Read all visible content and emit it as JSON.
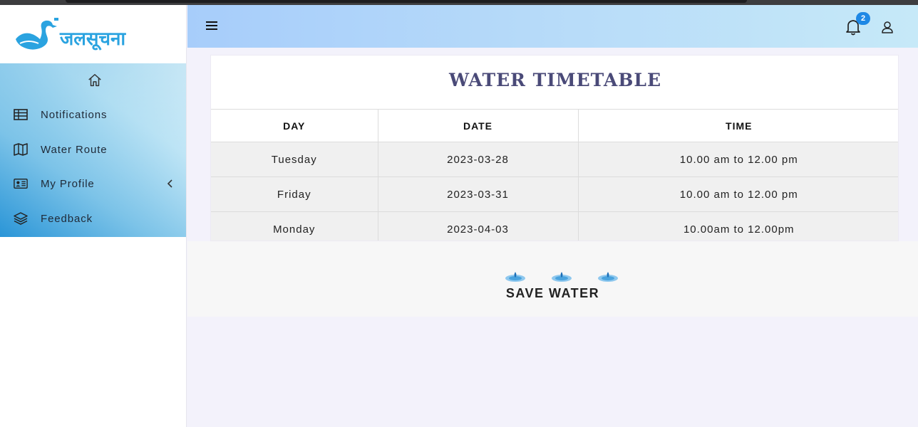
{
  "brand": {
    "name": "जलसूचना",
    "color": "#2aa3e0"
  },
  "sidebar": {
    "items": [
      {
        "label": "Notifications",
        "icon": "table-icon"
      },
      {
        "label": "Water Route",
        "icon": "map-icon"
      },
      {
        "label": "My Profile",
        "icon": "id-card-icon"
      },
      {
        "label": "Feedback",
        "icon": "layers-icon"
      }
    ]
  },
  "header": {
    "notification_count": "2"
  },
  "timetable": {
    "title": "WATER TIMETABLE",
    "columns": [
      "DAY",
      "DATE",
      "TIME"
    ],
    "rows": [
      [
        "Tuesday",
        "2023-03-28",
        "10.00 am to 12.00 pm"
      ],
      [
        "Friday",
        "2023-03-31",
        "10.00 am to 12.00 pm"
      ],
      [
        "Monday",
        "2023-04-03",
        "10.00am to 12.00pm"
      ]
    ]
  },
  "footer": {
    "slogan": "SAVE WATER"
  }
}
